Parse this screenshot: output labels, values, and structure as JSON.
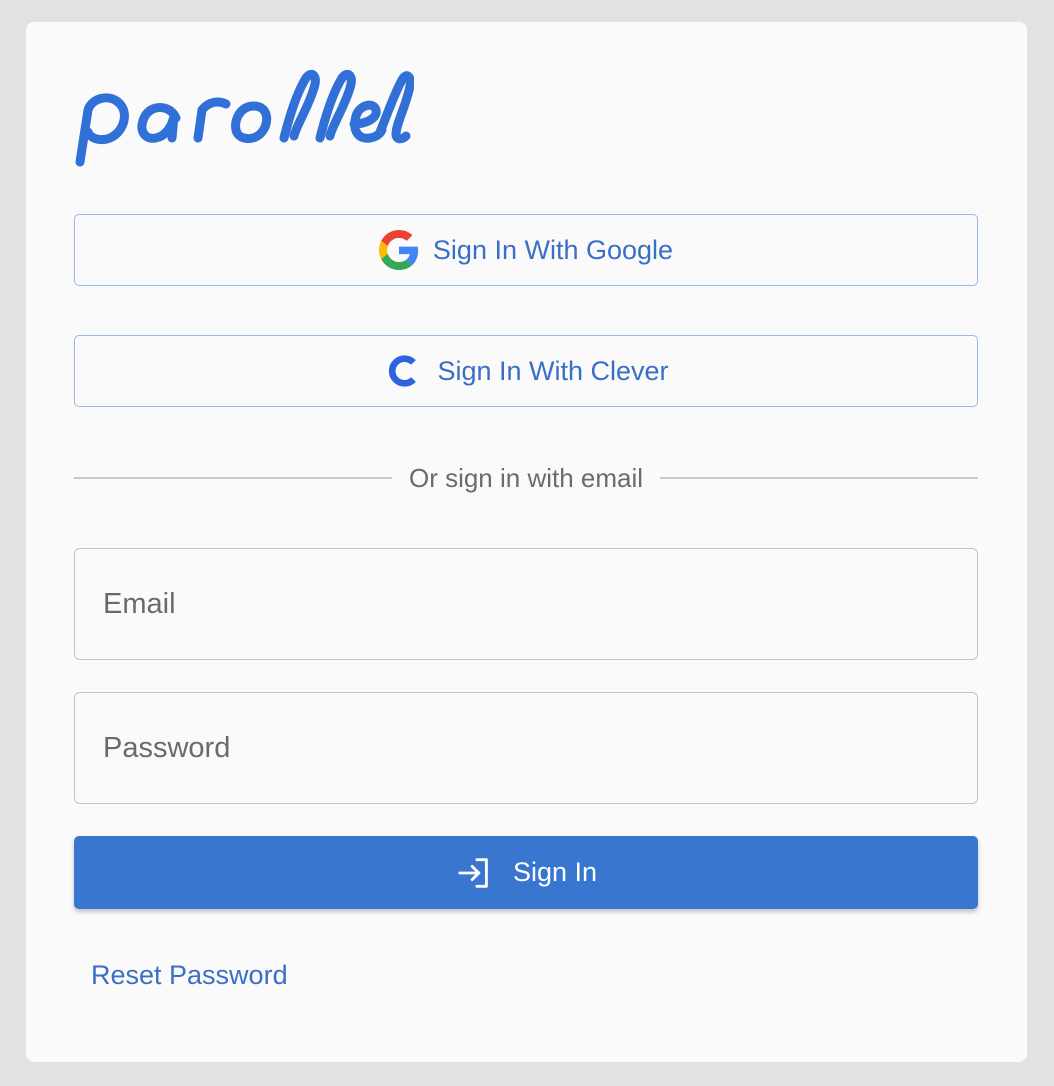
{
  "brand": {
    "logo_text": "parallel",
    "color": "#3170d6"
  },
  "oauth": {
    "google_label": "Sign In With Google",
    "clever_label": "Sign In With Clever"
  },
  "divider": {
    "text": "Or sign in with email"
  },
  "form": {
    "email_placeholder": "Email",
    "email_value": "",
    "password_placeholder": "Password",
    "password_value": "",
    "submit_label": "Sign In"
  },
  "links": {
    "reset_password": "Reset Password"
  },
  "colors": {
    "primary": "#3876cf",
    "link": "#3a6fc6",
    "oauth_border": "#9ab9e6",
    "background": "#e2e2e2",
    "card": "#fafafa"
  },
  "icons": {
    "google": "google-g-icon",
    "clever": "clever-c-icon",
    "sign_in": "sign-in-arrow-icon"
  }
}
